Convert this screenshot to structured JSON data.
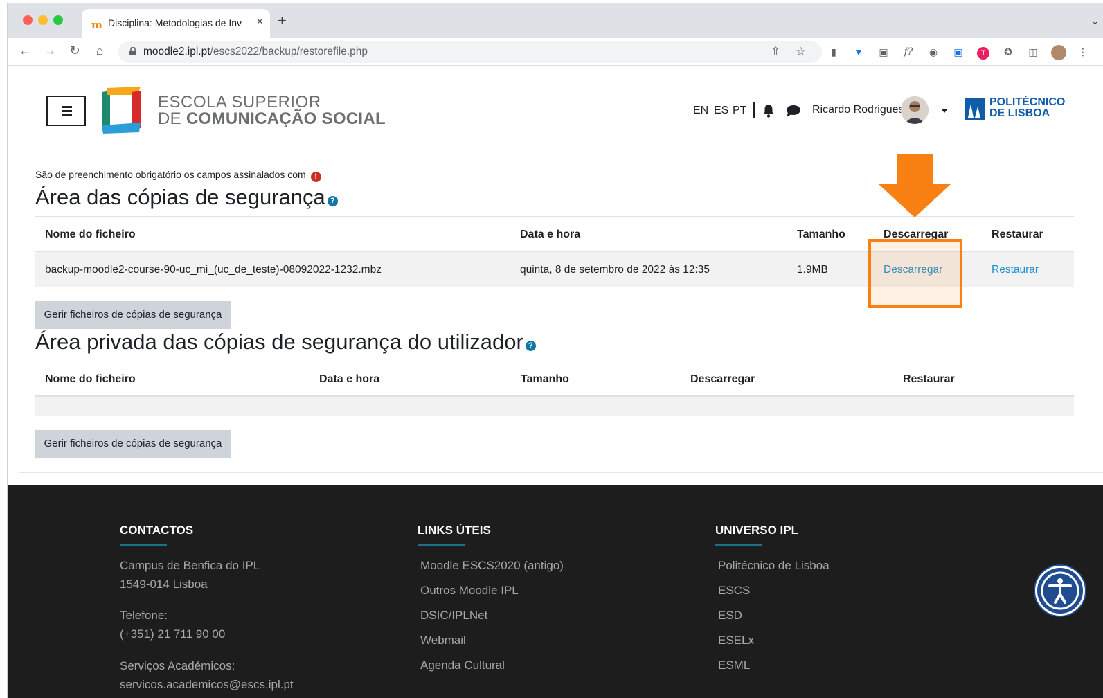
{
  "browser": {
    "tab_title": "Disciplina: Metodologias de Inv",
    "tab_favicon": "m",
    "url_domain": "moodle2.ipl.pt",
    "url_path": "/escs2022/backup/restorefile.php",
    "new_tab_icon": "+",
    "close_icon": "×"
  },
  "header": {
    "logo_line1": "ESCOLA SUPERIOR",
    "logo_line2_prefix": "DE ",
    "logo_line2_bold": "COMUNICAÇÃO SOCIAL",
    "languages": [
      "EN",
      "ES",
      "PT"
    ],
    "user_name": "Ricardo Rodrigues",
    "ipl_line1": "POLITÉCNICO",
    "ipl_line2": "DE LISBOA"
  },
  "content": {
    "required_note": "São de preenchimento obrigatório os campos assinalados com",
    "required_icon": "!",
    "help_icon": "?",
    "course_backups": {
      "heading": "Área das cópias de segurança",
      "columns": [
        "Nome do ficheiro",
        "Data e hora",
        "Tamanho",
        "Descarregar",
        "Restaurar"
      ],
      "rows": [
        {
          "filename": "backup-moodle2-course-90-uc_mi_(uc_de_teste)-08092022-1232.mbz",
          "datetime": "quinta, 8 de setembro de 2022 às 12:35",
          "size": "1.9MB",
          "download": "Descarregar",
          "restore": "Restaurar"
        }
      ],
      "manage_button": "Gerir ficheiros de cópias de segurança"
    },
    "user_backups": {
      "heading": "Área privada das cópias de segurança do utilizador",
      "columns": [
        "Nome do ficheiro",
        "Data e hora",
        "Tamanho",
        "Descarregar",
        "Restaurar"
      ],
      "manage_button": "Gerir ficheiros de cópias de segurança"
    }
  },
  "footer": {
    "contacts": {
      "title": "CONTACTOS",
      "address_line1": "Campus de Benfica do IPL",
      "address_line2": "1549-014 Lisboa",
      "phone_label": "Telefone:",
      "phone": "(+351) 21 711 90 00",
      "services_label": "Serviços Académicos:",
      "services_email": "servicos.academicos@escs.ipl.pt"
    },
    "links": {
      "title": "LINKS ÚTEIS",
      "items": [
        "Moodle ESCS2020 (antigo)",
        "Outros Moodle IPL",
        "DSIC/IPLNet",
        "Webmail",
        "Agenda Cultural"
      ]
    },
    "universe": {
      "title": "UNIVERSO IPL",
      "items": [
        "Politécnico de Lisboa",
        "ESCS",
        "ESD",
        "ESELx",
        "ESML"
      ]
    }
  },
  "colors": {
    "annotation": "#f98012",
    "link": "#1a8fd1",
    "footer_bg": "#1d1d1d",
    "brand_blue": "#0f5da8"
  }
}
